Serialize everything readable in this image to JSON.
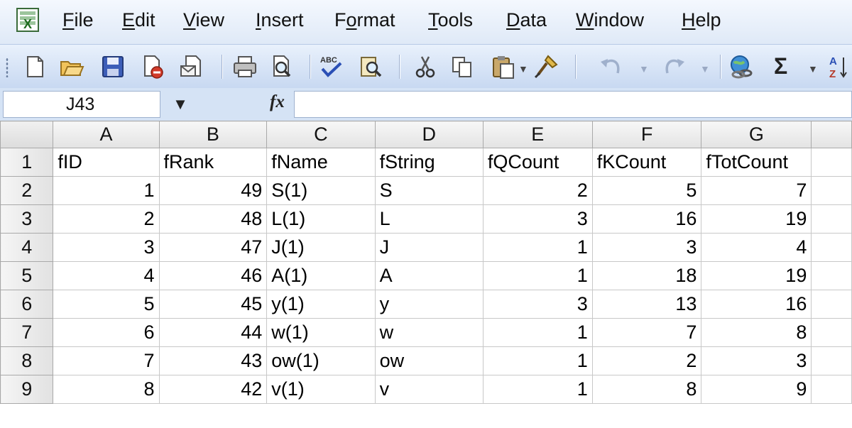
{
  "menu": {
    "items": [
      {
        "label": "File",
        "accel": "F",
        "rest": "ile"
      },
      {
        "label": "Edit",
        "accel": "E",
        "rest": "dit"
      },
      {
        "label": "View",
        "accel": "V",
        "rest": "iew"
      },
      {
        "label": "Insert",
        "accel": "I",
        "rest": "nsert"
      },
      {
        "label": "Format",
        "pre": "F",
        "accel": "o",
        "rest": "rmat"
      },
      {
        "label": "Tools",
        "accel": "T",
        "rest": "ools"
      },
      {
        "label": "Data",
        "accel": "D",
        "rest": "ata"
      },
      {
        "label": "Window",
        "accel": "W",
        "rest": "indow"
      },
      {
        "label": "Help",
        "accel": "H",
        "rest": "elp"
      }
    ]
  },
  "toolbar": {
    "spelling_label": "ABC",
    "autosum_label": "Σ",
    "sort_label": "A Z",
    "icons": [
      "new-icon",
      "open-icon",
      "save-icon",
      "permission-icon",
      "email-icon",
      "print-icon",
      "print-preview-icon",
      "spelling-icon",
      "research-icon",
      "cut-icon",
      "copy-icon",
      "paste-icon",
      "format-painter-icon",
      "undo-icon",
      "redo-icon",
      "hyperlink-icon",
      "autosum-icon",
      "sort-ascending-icon"
    ]
  },
  "formula_bar": {
    "name_box": "J43",
    "fx_label": "fx",
    "formula": ""
  },
  "sheet": {
    "columns": [
      "A",
      "B",
      "C",
      "D",
      "E",
      "F",
      "G"
    ],
    "rows": [
      {
        "num": "1",
        "cells": [
          "fID",
          "fRank",
          "fName",
          "fString",
          "fQCount",
          "fKCount",
          "fTotCount"
        ]
      },
      {
        "num": "2",
        "cells": [
          "1",
          "49",
          "S(1)",
          "S",
          "2",
          "5",
          "7"
        ]
      },
      {
        "num": "3",
        "cells": [
          "2",
          "48",
          "L(1)",
          "L",
          "3",
          "16",
          "19"
        ]
      },
      {
        "num": "4",
        "cells": [
          "3",
          "47",
          "J(1)",
          "J",
          "1",
          "3",
          "4"
        ]
      },
      {
        "num": "5",
        "cells": [
          "4",
          "46",
          "A(1)",
          "A",
          "1",
          "18",
          "19"
        ]
      },
      {
        "num": "6",
        "cells": [
          "5",
          "45",
          "y(1)",
          "y",
          "3",
          "13",
          "16"
        ]
      },
      {
        "num": "7",
        "cells": [
          "6",
          "44",
          "w(1)",
          "w",
          "1",
          "7",
          "8"
        ]
      },
      {
        "num": "8",
        "cells": [
          "7",
          "43",
          "ow(1)",
          "ow",
          "1",
          "2",
          "3"
        ]
      },
      {
        "num": "9",
        "cells": [
          "8",
          "42",
          "v(1)",
          "v",
          "1",
          "8",
          "9"
        ]
      }
    ]
  }
}
